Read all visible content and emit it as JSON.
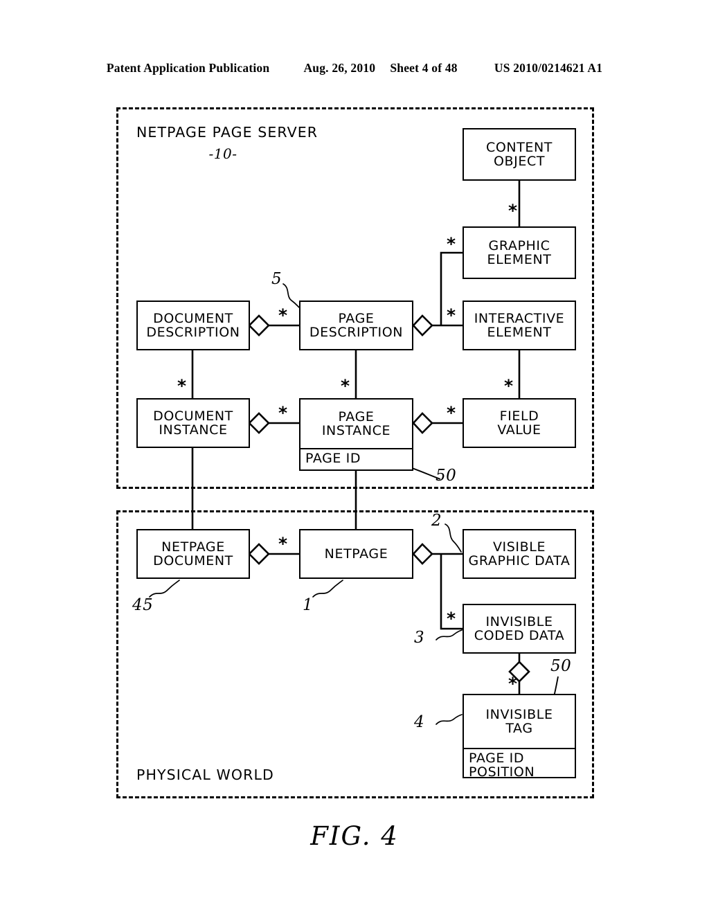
{
  "header": {
    "publication": "Patent Application Publication",
    "date": "Aug. 26, 2010",
    "sheet": "Sheet 4 of 48",
    "patent_number": "US 2010/0214621 A1"
  },
  "figure": {
    "caption": "FIG. 4",
    "panels": [
      {
        "id": "server",
        "title": "NETPAGE PAGE SERVER",
        "ref": "-10-"
      },
      {
        "id": "physical",
        "title": "PHYSICAL WORLD",
        "ref": ""
      }
    ],
    "boxes": [
      {
        "id": "content-object",
        "name": "CONTENT\nOBJECT",
        "attr": ""
      },
      {
        "id": "graphic-element",
        "name": "GRAPHIC\nELEMENT",
        "attr": ""
      },
      {
        "id": "document-description",
        "name": "DOCUMENT\nDESCRIPTION",
        "attr": ""
      },
      {
        "id": "page-description",
        "name": "PAGE\nDESCRIPTION",
        "attr": ""
      },
      {
        "id": "interactive-element",
        "name": "INTERACTIVE\nELEMENT",
        "attr": ""
      },
      {
        "id": "document-instance",
        "name": "DOCUMENT\nINSTANCE",
        "attr": ""
      },
      {
        "id": "page-instance",
        "name": "PAGE\nINSTANCE",
        "attr": "PAGE ID"
      },
      {
        "id": "field-value",
        "name": "FIELD\nVALUE",
        "attr": ""
      },
      {
        "id": "netpage-document",
        "name": "NETPAGE\nDOCUMENT",
        "attr": ""
      },
      {
        "id": "netpage",
        "name": "NETPAGE",
        "attr": ""
      },
      {
        "id": "visible-graphic",
        "name": "VISIBLE\nGRAPHIC DATA",
        "attr": ""
      },
      {
        "id": "invisible-coded",
        "name": "INVISIBLE\nCODED DATA",
        "attr": ""
      },
      {
        "id": "invisible-tag",
        "name": "INVISIBLE\nTAG",
        "attr": "PAGE ID\nPOSITION"
      }
    ],
    "multiplicities": [
      {
        "id": "m-content-graphic",
        "symbol": "*"
      },
      {
        "id": "m-graphic-pagedesc",
        "symbol": "*"
      },
      {
        "id": "m-docdesc-pagedesc",
        "symbol": "*"
      },
      {
        "id": "m-pagedesc-interactive",
        "symbol": "*"
      },
      {
        "id": "m-docdesc-docinst",
        "symbol": "*"
      },
      {
        "id": "m-pagedesc-pageinst",
        "symbol": "*"
      },
      {
        "id": "m-interactive-field",
        "symbol": "*"
      },
      {
        "id": "m-docinst-pageinst",
        "symbol": "*"
      },
      {
        "id": "m-pageinst-field",
        "symbol": "*"
      },
      {
        "id": "m-netpagedoc-netpage",
        "symbol": "*"
      },
      {
        "id": "m-netpage-invisible",
        "symbol": "*"
      },
      {
        "id": "m-coded-tag",
        "symbol": "*"
      }
    ],
    "reference_numerals": [
      {
        "id": "ref-5",
        "value": "5",
        "target": "page-description"
      },
      {
        "id": "ref-50-top",
        "value": "50",
        "target": "page-instance-page-id"
      },
      {
        "id": "ref-45",
        "value": "45",
        "target": "netpage-document"
      },
      {
        "id": "ref-1",
        "value": "1",
        "target": "netpage"
      },
      {
        "id": "ref-2",
        "value": "2",
        "target": "visible-graphic"
      },
      {
        "id": "ref-3",
        "value": "3",
        "target": "invisible-coded"
      },
      {
        "id": "ref-4",
        "value": "4",
        "target": "invisible-tag"
      },
      {
        "id": "ref-50-bot",
        "value": "50",
        "target": "invisible-tag-page-id"
      }
    ]
  }
}
